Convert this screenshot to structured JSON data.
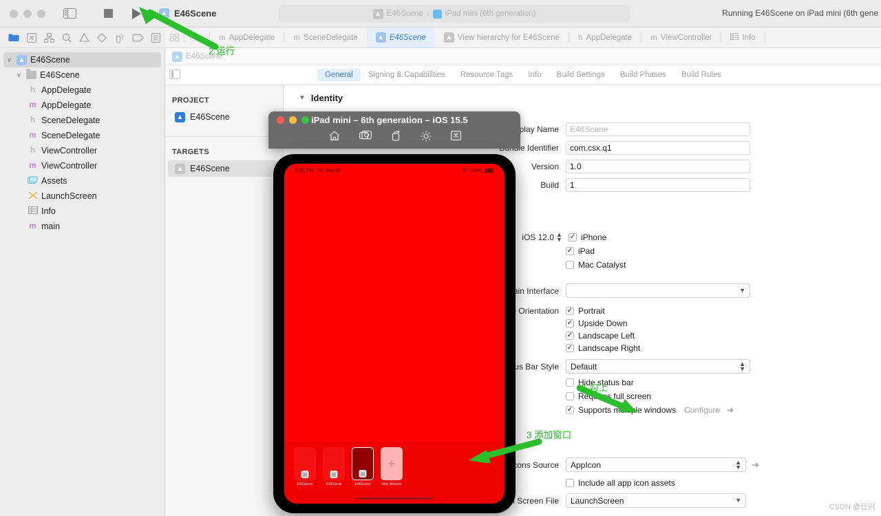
{
  "toolbar": {
    "scheme_name": "E46Scene",
    "breadcrumb_project": "E46Scene",
    "breadcrumb_sep": "›",
    "breadcrumb_device": "iPad mini (6th generation)",
    "run_status": "Running E46Scene on iPad mini (6th gene",
    "icons": {
      "sidebar": "sidebar-toggle-icon",
      "stop": "stop-icon",
      "run": "run-icon"
    }
  },
  "navigator_toolbar": {
    "icons": [
      {
        "name": "project-navigator-icon"
      },
      {
        "name": "source-control-navigator-icon"
      },
      {
        "name": "symbol-navigator-icon"
      },
      {
        "name": "find-navigator-icon"
      },
      {
        "name": "issue-navigator-icon"
      },
      {
        "name": "test-navigator-icon"
      },
      {
        "name": "debug-navigator-icon"
      },
      {
        "name": "breakpoint-navigator-icon"
      },
      {
        "name": "report-navigator-icon"
      }
    ]
  },
  "navigator": {
    "items": [
      {
        "label": "E46Scene",
        "icon": "xcode-project-icon",
        "level": 0,
        "disclosure": "v",
        "selected": true
      },
      {
        "label": "E46Scene",
        "icon": "folder-icon",
        "level": 1,
        "disclosure": "v",
        "selected": false
      },
      {
        "label": "AppDelegate",
        "icon": "h",
        "level": 2,
        "disclosure": "",
        "selected": false
      },
      {
        "label": "AppDelegate",
        "icon": "m",
        "level": 2,
        "disclosure": "",
        "selected": false
      },
      {
        "label": "SceneDelegate",
        "icon": "h",
        "level": 2,
        "disclosure": "",
        "selected": false
      },
      {
        "label": "SceneDelegate",
        "icon": "m",
        "level": 2,
        "disclosure": "",
        "selected": false
      },
      {
        "label": "ViewController",
        "icon": "h",
        "level": 2,
        "disclosure": "",
        "selected": false
      },
      {
        "label": "ViewController",
        "icon": "m",
        "level": 2,
        "disclosure": "",
        "selected": false
      },
      {
        "label": "Assets",
        "icon": "assets-icon",
        "level": 2,
        "disclosure": "",
        "selected": false
      },
      {
        "label": "LaunchScreen",
        "icon": "storyboard-icon",
        "level": 2,
        "disclosure": "",
        "selected": false
      },
      {
        "label": "Info",
        "icon": "plist-icon",
        "level": 2,
        "disclosure": "",
        "selected": false
      },
      {
        "label": "main",
        "icon": "m",
        "level": 2,
        "disclosure": "",
        "selected": false
      }
    ]
  },
  "editor_tabs": [
    {
      "label": "AppDelegate",
      "kind": "m",
      "active": false
    },
    {
      "label": "SceneDelegate",
      "kind": "m",
      "active": false
    },
    {
      "label": "E46Scene",
      "kind": "project",
      "active": true
    },
    {
      "label": "View hierarchy for E46Scene",
      "kind": "project",
      "active": false
    },
    {
      "label": "AppDelegate",
      "kind": "h",
      "active": false
    },
    {
      "label": "ViewController",
      "kind": "m",
      "active": false
    },
    {
      "label": "Info",
      "kind": "plist",
      "active": false
    }
  ],
  "jumpbar": {
    "label": "E46Scene"
  },
  "settings_tabs": [
    {
      "label": "General",
      "active": true
    },
    {
      "label": "Signing & Capabilities",
      "active": false
    },
    {
      "label": "Resource Tags",
      "active": false
    },
    {
      "label": "Info",
      "active": false
    },
    {
      "label": "Build Settings",
      "active": false
    },
    {
      "label": "Build Phases",
      "active": false
    },
    {
      "label": "Build Rules",
      "active": false
    }
  ],
  "project_pane": {
    "project_header": "PROJECT",
    "project_item": "E46Scene",
    "targets_header": "TARGETS",
    "target_item": "E46Scene"
  },
  "general": {
    "section_identity": "Identity",
    "display_name_label": "Display Name",
    "display_name_placeholder": "E46Scene",
    "bundle_id_label": "Bundle Identifier",
    "bundle_id_value": "com.csx.q1",
    "version_label": "Version",
    "version_value": "1.0",
    "build_label": "Build",
    "build_value": "1",
    "deployment_target": "iOS 12.0",
    "devices": [
      {
        "label": "iPhone",
        "checked": true
      },
      {
        "label": "iPad",
        "checked": true
      },
      {
        "label": "Mac Catalyst",
        "checked": false
      }
    ],
    "main_interface_label": "Main Interface",
    "main_interface_value": "",
    "device_orientation_label": "Device Orientation",
    "orientations": [
      {
        "label": "Portrait",
        "checked": true
      },
      {
        "label": "Upside Down",
        "checked": true
      },
      {
        "label": "Landscape Left",
        "checked": true
      },
      {
        "label": "Landscape Right",
        "checked": true
      }
    ],
    "status_bar_style_label": "Status Bar Style",
    "status_bar_style_value": "Default",
    "status_options": [
      {
        "label": "Hide status bar",
        "checked": false
      },
      {
        "label": "Requires full screen",
        "checked": false
      },
      {
        "label": "Supports multiple windows",
        "checked": true
      }
    ],
    "configure_label": "Configure",
    "app_icons_source_label": "App Icons Source",
    "app_icons_source_value": "AppIcon",
    "include_all_icons_label": "Include all app icon assets",
    "include_all_icons_checked": false,
    "launch_screen_label": "Launch Screen File",
    "launch_screen_value": "LaunchScreen"
  },
  "simulator": {
    "window_title": "iPad mini – 6th generation – iOS 15.5",
    "toolbar_icons": [
      {
        "name": "home-icon"
      },
      {
        "name": "screenshot-icon"
      },
      {
        "name": "rotate-icon"
      },
      {
        "name": "brightness-icon"
      },
      {
        "name": "keyboard-icon"
      }
    ],
    "ios_status": {
      "time": "2:01 PM",
      "date": "Fri Sep 30",
      "wifi": "wifi-icon",
      "battery_percent": "100%"
    },
    "switcher_cards": [
      {
        "label": "E46Scene",
        "type": "window",
        "active": false
      },
      {
        "label": "E46Scene",
        "type": "window",
        "active": false
      },
      {
        "label": "E46Scene",
        "type": "window",
        "active": true
      },
      {
        "label": "New Window",
        "type": "new",
        "active": false
      }
    ]
  },
  "annotations": [
    {
      "id": "a1",
      "text": "1 勾上"
    },
    {
      "id": "a2",
      "text": "2 运行"
    },
    {
      "id": "a3",
      "text": "3 添加窗口"
    }
  ],
  "watermark": "CSDN @仕兴",
  "colors": {
    "accent_blue": "#3b7fd4",
    "annotation_green": "#22bb22",
    "app_red": "#fe0000",
    "toolbar_bg": "#ececec"
  }
}
